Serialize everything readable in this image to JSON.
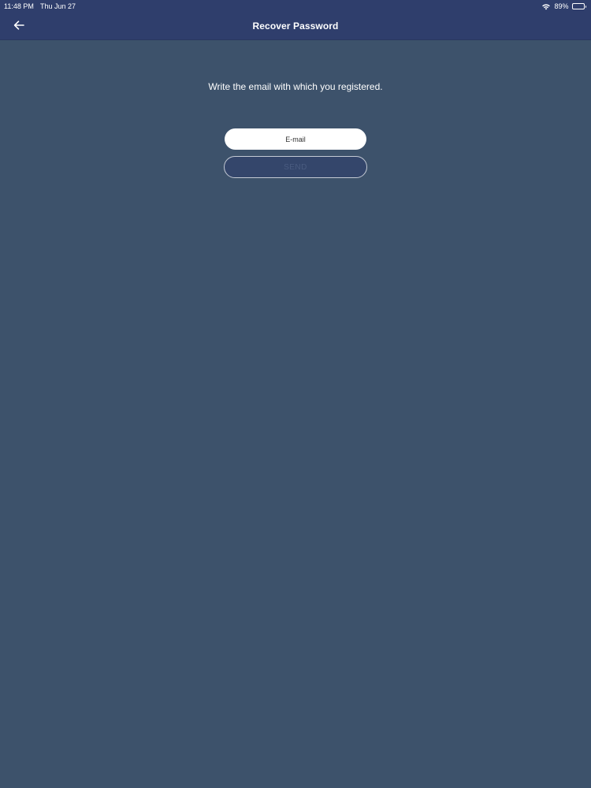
{
  "status_bar": {
    "time": "11:48 PM",
    "date": "Thu Jun 27",
    "battery_text": "89%",
    "battery_level": 0.89,
    "wifi_icon": "wifi-icon",
    "battery_icon": "battery-icon"
  },
  "nav": {
    "title": "Recover Password",
    "back_icon": "arrow-left-icon"
  },
  "form": {
    "prompt": "Write the email with which you registered.",
    "email_placeholder": "E-mail",
    "email_value": "",
    "send_label": "SEND"
  },
  "colors": {
    "background": "#3d526b",
    "header": "#2f3e6c",
    "send_button_bg": "#34466b",
    "send_button_text": "#4a5c80",
    "text": "#ffffff"
  }
}
